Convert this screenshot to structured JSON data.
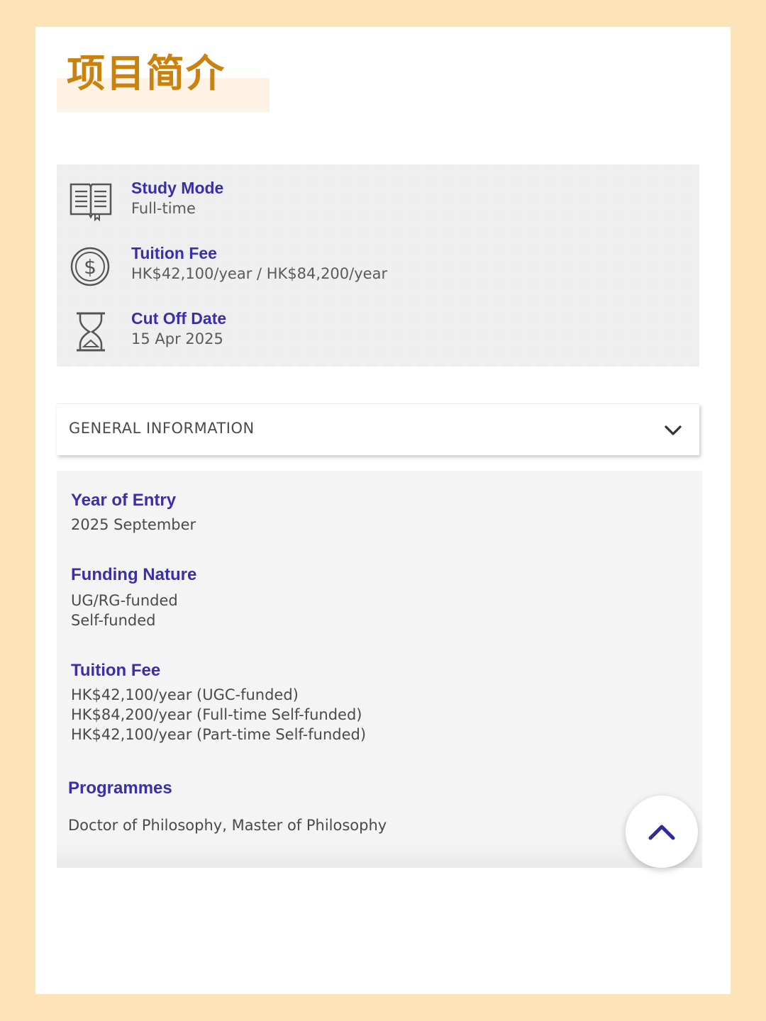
{
  "page_title": "项目简介",
  "summary": {
    "items": [
      {
        "label": "Study Mode",
        "value": "Full-time",
        "icon": "book-icon"
      },
      {
        "label": "Tuition Fee",
        "value": "HK$42,100/year / HK$84,200/year",
        "icon": "dollar-coin-icon"
      },
      {
        "label": "Cut Off Date",
        "value": "15 Apr 2025",
        "icon": "hourglass-icon"
      }
    ]
  },
  "accordion": {
    "title": "GENERAL INFORMATION",
    "icon": "chevron-down-icon"
  },
  "details": {
    "year_of_entry": {
      "label": "Year of Entry",
      "values": [
        "2025 September"
      ]
    },
    "funding_nature": {
      "label": "Funding Nature",
      "values": [
        "UG/RG-funded",
        "Self-funded"
      ]
    },
    "tuition_fee": {
      "label": "Tuition Fee",
      "values": [
        "HK$42,100/year (UGC-funded)",
        "HK$84,200/year (Full-time Self-funded)",
        "HK$42,100/year (Part-time Self-funded)"
      ]
    },
    "programmes": {
      "label": "Programmes",
      "values": [
        "Doctor of Philosophy, Master of Philosophy"
      ]
    }
  },
  "scroll_top": {
    "icon": "chevron-up-icon"
  },
  "colors": {
    "page_background": "#fde4b8",
    "title": "#c9810f",
    "accent": "#3a2fa8"
  }
}
